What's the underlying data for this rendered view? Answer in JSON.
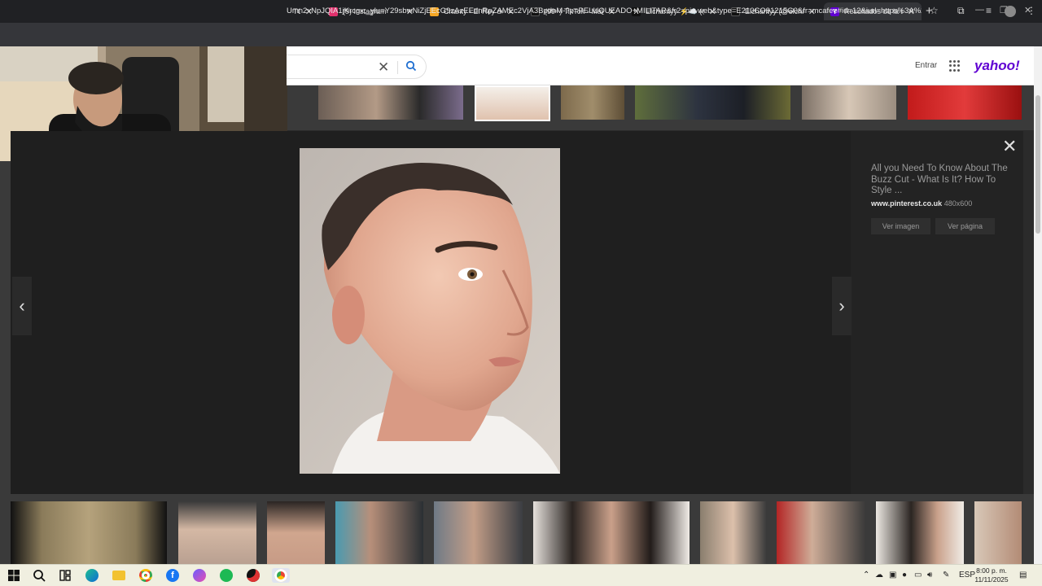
{
  "browser": {
    "tabs": [
      {
        "label": "TOR",
        "favicon_color": "#3b3b3b"
      },
      {
        "label": "(9) Instagram",
        "favicon_color": "#e1306c"
      },
      {
        "label": "Chanty - El Rey del B",
        "favicon_color": "#f5a623"
      },
      {
        "label": "(99+) TikTok - Make Y",
        "favicon_color": "#000000"
      },
      {
        "label": "Elchantyy ⚡☁️ (@El",
        "favicon_color": "#000000"
      },
      {
        "label": "Elchantyy (@elchanty",
        "favicon_color": "#000000"
      },
      {
        "label": "Resultados de la búsq",
        "favicon_color": "#6001d2"
      }
    ],
    "active_tab_index": 6,
    "url": "Umn2xNpJQIA1jKrcgx;_ylu=Y29sbwNiZjEEcG9zAzEEdnRpZAMEc2VjA3BpdnM-?p=PELUQUEADO+MILITAR&fr2=piv-web&type=E210CO91215G0&fr=mcafee#id=12&iurl=https%3A%2F%2..."
  },
  "yahoo": {
    "signin_label": "Entrar",
    "logo": "yahoo!",
    "brand_color": "#6001d2"
  },
  "viewer": {
    "title": "All you Need To Know About The Buzz Cut - What Is It? How To Style ...",
    "source": "www.pinterest.co.uk",
    "dimensions": "480x600",
    "view_image_label": "Ver imagen",
    "view_page_label": "Ver página"
  },
  "taskbar": {
    "language": "ESP",
    "time": "8:00 p. m.",
    "date": "11/11/2025"
  }
}
